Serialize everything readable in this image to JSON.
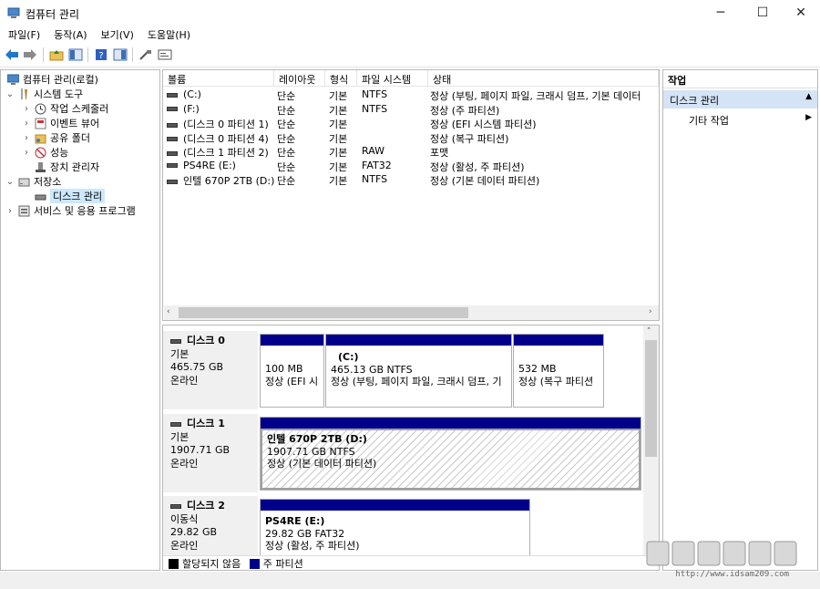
{
  "window": {
    "title": "컴퓨터 관리",
    "minimize": "─",
    "maximize": "☐",
    "close": "✕"
  },
  "menu": [
    "파일(F)",
    "동작(A)",
    "보기(V)",
    "도움말(H)"
  ],
  "tree": {
    "root": "컴퓨터 관리(로컬)",
    "system_tools": "시스템 도구",
    "task_scheduler": "작업 스케줄러",
    "event_viewer": "이벤트 뷰어",
    "shared_folders": "공유 폴더",
    "performance": "성능",
    "device_manager": "장치 관리자",
    "storage": "저장소",
    "disk_management": "디스크 관리",
    "services_apps": "서비스 및 응용 프로그램"
  },
  "columns": [
    "볼륨",
    "레이아웃",
    "형식",
    "파일 시스템",
    "상태"
  ],
  "volumes": [
    {
      "name": "(C:)",
      "layout": "단순",
      "type": "기본",
      "fs": "NTFS",
      "status": "정상 (부팅, 페이지 파일, 크래시 덤프, 기본 데이터"
    },
    {
      "name": "(F:)",
      "layout": "단순",
      "type": "기본",
      "fs": "NTFS",
      "status": "정상 (주 파티션)"
    },
    {
      "name": "(디스크 0 파티션 1)",
      "layout": "단순",
      "type": "기본",
      "fs": "",
      "status": "정상 (EFI 시스템 파티션)"
    },
    {
      "name": "(디스크 0 파티션 4)",
      "layout": "단순",
      "type": "기본",
      "fs": "",
      "status": "정상 (복구 파티션)"
    },
    {
      "name": "(디스크 1 파티션 2)",
      "layout": "단순",
      "type": "기본",
      "fs": "RAW",
      "status": "포맷"
    },
    {
      "name": "PS4RE (E:)",
      "layout": "단순",
      "type": "기본",
      "fs": "FAT32",
      "status": "정상 (활성, 주 파티션)"
    },
    {
      "name": "인텔 670P 2TB (D:)",
      "layout": "단순",
      "type": "기본",
      "fs": "NTFS",
      "status": "정상 (기본 데이터 파티션)"
    }
  ],
  "disks": [
    {
      "name": "디스크 0",
      "kind": "기본",
      "size": "465.75 GB",
      "state": "온라인",
      "parts": [
        {
          "title": "",
          "line1": "100 MB",
          "line2": "정상 (EFI 시"
        },
        {
          "title": "(C:)",
          "line1": "465.13 GB NTFS",
          "line2": "정상 (부팅, 페이지 파일, 크래시 덤프, 기"
        },
        {
          "title": "",
          "line1": "532 MB",
          "line2": "정상 (복구 파티션"
        }
      ]
    },
    {
      "name": "디스크 1",
      "kind": "기본",
      "size": "1907.71 GB",
      "state": "온라인",
      "parts": [
        {
          "title": "인텔 670P 2TB  (D:)",
          "line1": "1907.71 GB NTFS",
          "line2": "정상 (기본 데이터 파티션)"
        }
      ]
    },
    {
      "name": "디스크 2",
      "kind": "이동식",
      "size": "29.82 GB",
      "state": "온라인",
      "parts": [
        {
          "title": "PS4RE  (E:)",
          "line1": "29.82 GB FAT32",
          "line2": "정상 (활성, 주 파티션)"
        }
      ]
    }
  ],
  "legend": {
    "unallocated": "할당되지 않음",
    "primary": "주 파티션"
  },
  "actions": {
    "header": "작업",
    "section": "디스크 관리",
    "more": "기타 작업"
  },
  "watermark": "http://www.idsam209.com",
  "colors": {
    "partition_bar": "#00008b",
    "selection": "#cce8ff",
    "unallocated": "#000000"
  }
}
